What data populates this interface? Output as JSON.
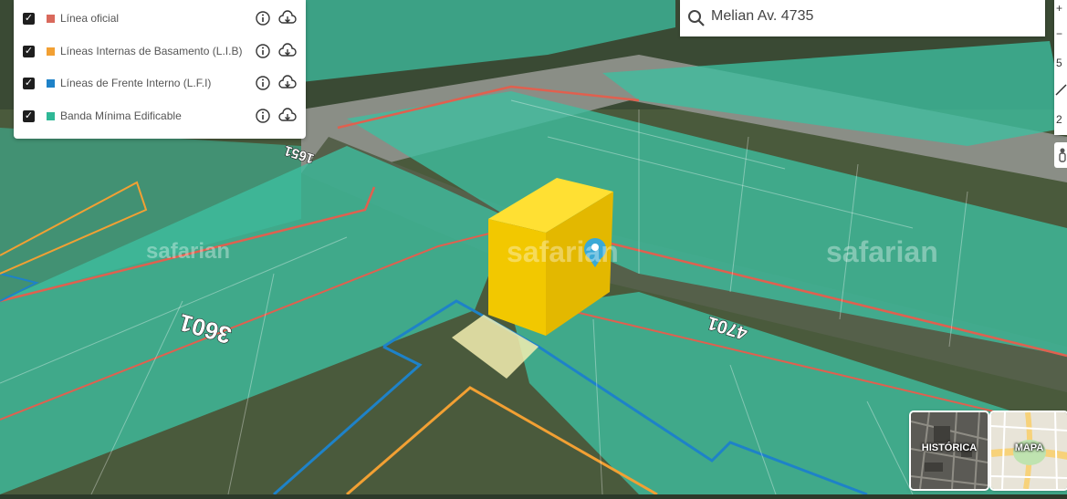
{
  "layers": [
    {
      "label": "Línea oficial",
      "color": "#d9695c",
      "checked": true,
      "check": "✓"
    },
    {
      "label": "Líneas Internas de Basamento (L.I.B)",
      "color": "#f2a033",
      "checked": true,
      "check": "✓"
    },
    {
      "label": "Líneas de Frente Interno (L.F.I)",
      "color": "#1e82c8",
      "checked": true,
      "check": "✓"
    },
    {
      "label": "Banda Mínima Edificable",
      "color": "#2fb896",
      "checked": true,
      "check": "✓"
    }
  ],
  "search": {
    "value": "Melian Av. 4735",
    "icon": "search-icon"
  },
  "map": {
    "street_numbers": [
      "1651",
      "3601",
      "4701"
    ],
    "watermark": "safarian",
    "building_color": "#f2c800",
    "band_color": "#3dbfa0",
    "official_line_color": "#e0604f",
    "lfi_color": "#1e82c8",
    "lib_color": "#f2a033"
  },
  "controls": {
    "items": [
      "+",
      "−",
      "5",
      "2"
    ]
  },
  "basemaps": [
    {
      "label": "HISTÓRICA"
    },
    {
      "label": "MAPA"
    }
  ]
}
